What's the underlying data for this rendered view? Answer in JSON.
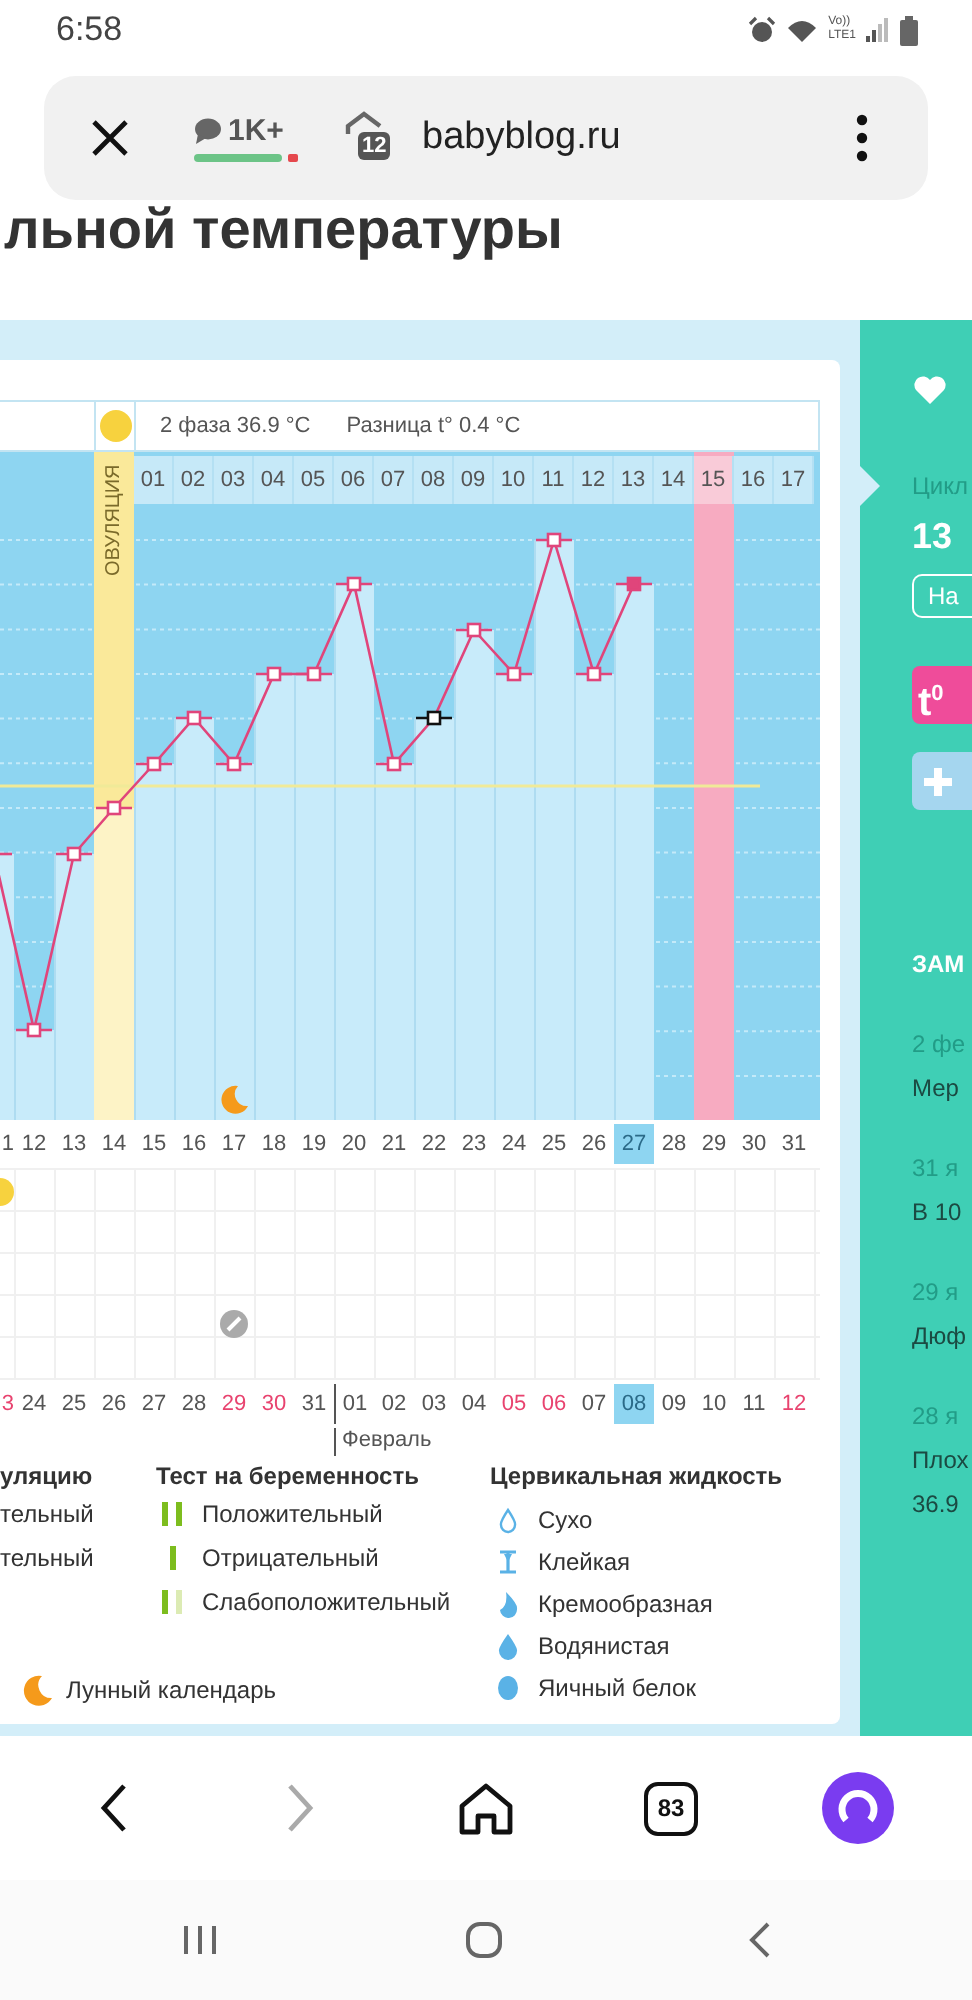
{
  "status_bar": {
    "time": "6:58",
    "volte": "Vo))",
    "network": "LTE1"
  },
  "browser_bar": {
    "comments": "1K+",
    "tabs_badge": "12",
    "url": "babyblog.ru"
  },
  "page": {
    "heading": "льной температуры"
  },
  "chart": {
    "phase_info": "2 фаза 36.9 °C",
    "difference": "Разница t° 0.4 °C",
    "ovulation_label": "ОВУЛЯЦИЯ",
    "cycle_days": [
      {
        "label": "01",
        "marked": false
      },
      {
        "label": "02",
        "marked": false
      },
      {
        "label": "03",
        "marked": false
      },
      {
        "label": "04",
        "marked": false
      },
      {
        "label": "05",
        "marked": false
      },
      {
        "label": "06",
        "marked": false
      },
      {
        "label": "07",
        "marked": false
      },
      {
        "label": "08",
        "marked": false
      },
      {
        "label": "09",
        "marked": false
      },
      {
        "label": "10",
        "marked": false
      },
      {
        "label": "11",
        "marked": false
      },
      {
        "label": "12",
        "marked": false
      },
      {
        "label": "13",
        "marked": false
      },
      {
        "label": "14",
        "marked": false
      },
      {
        "label": "15",
        "marked": true
      },
      {
        "label": "16",
        "marked": false
      },
      {
        "label": "17",
        "marked": false
      }
    ],
    "dates": [
      {
        "label": "1",
        "selected": false
      },
      {
        "label": "12",
        "selected": false
      },
      {
        "label": "13",
        "selected": false
      },
      {
        "label": "14",
        "selected": false
      },
      {
        "label": "15",
        "selected": false
      },
      {
        "label": "16",
        "selected": false
      },
      {
        "label": "17",
        "selected": false
      },
      {
        "label": "18",
        "selected": false
      },
      {
        "label": "19",
        "selected": false
      },
      {
        "label": "20",
        "selected": false
      },
      {
        "label": "21",
        "selected": false
      },
      {
        "label": "22",
        "selected": false
      },
      {
        "label": "23",
        "selected": false
      },
      {
        "label": "24",
        "selected": false
      },
      {
        "label": "25",
        "selected": false
      },
      {
        "label": "26",
        "selected": false
      },
      {
        "label": "27",
        "selected": true
      },
      {
        "label": "28",
        "selected": false
      },
      {
        "label": "29",
        "selected": false
      },
      {
        "label": "30",
        "selected": false
      },
      {
        "label": "31",
        "selected": false
      }
    ],
    "dates_next": [
      {
        "label": "3",
        "selected": false,
        "weekend": true,
        "month_start": false
      },
      {
        "label": "24",
        "selected": false,
        "weekend": false,
        "month_start": false
      },
      {
        "label": "25",
        "selected": false,
        "weekend": false,
        "month_start": false
      },
      {
        "label": "26",
        "selected": false,
        "weekend": false,
        "month_start": false
      },
      {
        "label": "27",
        "selected": false,
        "weekend": false,
        "month_start": false
      },
      {
        "label": "28",
        "selected": false,
        "weekend": false,
        "month_start": false
      },
      {
        "label": "29",
        "selected": false,
        "weekend": true,
        "month_start": false
      },
      {
        "label": "30",
        "selected": false,
        "weekend": true,
        "month_start": false
      },
      {
        "label": "31",
        "selected": false,
        "weekend": false,
        "month_start": false
      },
      {
        "label": "01",
        "selected": false,
        "weekend": false,
        "month_start": true
      },
      {
        "label": "02",
        "selected": false,
        "weekend": false,
        "month_start": false
      },
      {
        "label": "03",
        "selected": false,
        "weekend": false,
        "month_start": false
      },
      {
        "label": "04",
        "selected": false,
        "weekend": false,
        "month_start": false
      },
      {
        "label": "05",
        "selected": false,
        "weekend": true,
        "month_start": false
      },
      {
        "label": "06",
        "selected": false,
        "weekend": true,
        "month_start": false
      },
      {
        "label": "07",
        "selected": false,
        "weekend": false,
        "month_start": false
      },
      {
        "label": "08",
        "selected": true,
        "weekend": false,
        "month_start": false
      },
      {
        "label": "09",
        "selected": false,
        "weekend": false,
        "month_start": false
      },
      {
        "label": "10",
        "selected": false,
        "weekend": false,
        "month_start": false
      },
      {
        "label": "11",
        "selected": false,
        "weekend": false,
        "month_start": false
      },
      {
        "label": "12",
        "selected": false,
        "weekend": true,
        "month_start": false
      }
    ],
    "month_label": "Февраль"
  },
  "legend": {
    "groups": [
      {
        "title": "уляцию",
        "items": [
          {
            "label": "тельный"
          },
          {
            "label": "тельный"
          }
        ]
      },
      {
        "title": "Тест на беременность",
        "items": [
          {
            "label": "Положительный",
            "kind": "positive"
          },
          {
            "label": "Отрицательный",
            "kind": "negative"
          },
          {
            "label": "Слабоположительный",
            "kind": "faint"
          }
        ]
      },
      {
        "title": "Цервикальная жидкость",
        "items": [
          {
            "label": "Сухо",
            "kind": "dry"
          },
          {
            "label": "Клейкая",
            "kind": "sticky"
          },
          {
            "label": "Кремообразная",
            "kind": "creamy"
          },
          {
            "label": "Водянистая",
            "kind": "watery"
          },
          {
            "label": "Яичный белок",
            "kind": "eggwhite"
          }
        ]
      }
    ],
    "moon_label": "Лунный календарь"
  },
  "side_panel": {
    "cycle_label": "Цикл",
    "cycle_value": "13",
    "button": "На",
    "temperature_tile": "t$^{0}$",
    "notes_title": "ЗАМ",
    "notes": [
      {
        "date": "2 фе",
        "lines": [
          "Мер"
        ]
      },
      {
        "date": "31 я",
        "lines": [
          "В 10"
        ]
      },
      {
        "date": "29 я",
        "lines": [
          "Дюф"
        ]
      },
      {
        "date": "28 я",
        "lines": [
          "Плох",
          "36.9"
        ]
      }
    ]
  },
  "browser_nav": {
    "tabs_count": "83"
  }
}
